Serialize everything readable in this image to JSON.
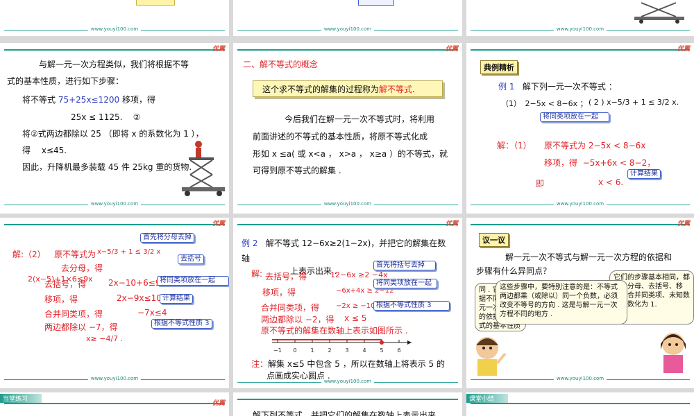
{
  "url": "www.youyi100.com",
  "logo": "优翼",
  "slide_a": {
    "p1": "与解一元一次方程类似，我们将根据不等",
    "p2": "式的基本性质，进行如下步骤：",
    "p3a": "将不等式",
    "p3b": "75+25x≤1200",
    "p3c": "移项，得",
    "p4": "25x ≤ 1125.",
    "p4tag": "②",
    "p5": "将②式两边都除以 25 （即将 x 的系数化为 1 ），",
    "p6": "得　 x≤45.",
    "p7": "因此，升降机最多装载 45 件 25kg 重的货物."
  },
  "slide_b": {
    "heading": "二、解不等式的概念",
    "box_a": "这个求不等式的解集的过程称为",
    "box_b": "解不等式",
    "box_c": ".",
    "l1": "今后我们在解一元一次不等式时，将利用",
    "l2": "前面讲述的不等式的基本性质，将原不等式化成",
    "l3": "形如 x ≤a( 或 x<a ， x>a ， x≥a ）的不等式，就",
    "l4": "可得到原不等式的解集 ."
  },
  "slide_c": {
    "section": "典例精析",
    "ex": "例 1",
    "ex_text": "解下列一元一次不等式 ：",
    "q1": "（1）　2−5x < 8−6x ；",
    "q2": "( 2 ) x−5/3 + 1 ≤ 3/2 x.",
    "call1": "将同类项放在一起",
    "s_label": "解：（1）",
    "s1": "原不等式为 2−5x < 8−6x",
    "s2a": "移项，得",
    "s2b": "−5x+6x < 8−2，",
    "s3a": "即",
    "s3b": "x < 6.",
    "call2": "计算结果"
  },
  "slide_d": {
    "call0": "首先将分母去掉",
    "l1a": "解:（2）",
    "l1b": "原不等式为",
    "l1c": "x−5/3 + 1 ≤ 3/2 x",
    "l2": "去分母，得",
    "call1": "去括号",
    "l3": "2(x−5)+1×6≤9x",
    "l4a": "去括号，得",
    "l4b": "2x−10+6≤9x",
    "call2": "将同类项放在一起",
    "l5a": "移项，得",
    "l5b": "2x−9x≤10−6",
    "call3": "计算结果",
    "l6a": "合并同类项，得",
    "l6b": "−7x≤4",
    "l7": "两边都除以 −7，得",
    "call4": "根据不等式性质 3",
    "l8": "x≥ −4/7 ."
  },
  "slide_e": {
    "ex": "例 2",
    "q1": "解不等式 12−6x≥2(1−2x)，并把它的解集在数",
    "q2": "轴",
    "q3": "上表示出来 .",
    "sol": "解:",
    "s1a": "去括号，得",
    "s1b": "12−6x ≥2 −4x",
    "c1": "首先将括号去掉",
    "s2a": "移项，得",
    "s2b": "−6x+4x ≥ 2−12",
    "c2": "将同类项放在一起",
    "s3a": "合并同类项，得",
    "s3b": "−2x ≥ −10",
    "c3": "根据不等式性质 3",
    "s4a": "两边都除以 −2，得",
    "s4b": "x ≤ 5",
    "s5": "原不等式的解集在数轴上表示如图所示 .",
    "ticks": [
      "−1",
      "0",
      "1",
      "2",
      "3",
      "4",
      "5",
      "6"
    ],
    "note_a": "注：",
    "note_b": "解集 x≤5 中包含 5 ，所以在数轴上将表示 5 的",
    "note_c": "点画成实心圆点 ."
  },
  "slide_f": {
    "section": "议一议",
    "q1": "解一元一次不等式与解一元一次方程的依据和",
    "q2": "步骤有什么异同点？",
    "b1": "同 . 它们的依据不同，解一元一次不等式的依据是不等式的基本性质",
    "b2": "这些步骤中，要特别注意的是：不等式两边都乘（或除以）同一个负数，必须改变不等号的方向 . 这是与解一元一次方程不同的地方 .",
    "b3": "它们的步骤基本相同，都是去分母、去括号、移项、合并同类项、未知数的系数化为 1."
  },
  "bottom": {
    "left": "当堂练习",
    "mid": "解下列不等式，并把它们的解集在数轴上表示出来",
    "right": "课堂小结"
  }
}
